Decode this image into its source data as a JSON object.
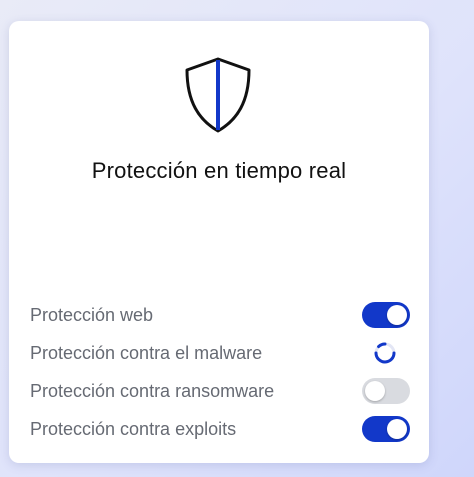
{
  "panel": {
    "title": "Protección en tiempo real",
    "icon": "shield-icon",
    "accent_color": "#1238c9"
  },
  "protections": [
    {
      "label": "Protección web",
      "state": "on"
    },
    {
      "label": "Protección contra el malware",
      "state": "loading"
    },
    {
      "label": "Protección contra ransomware",
      "state": "off"
    },
    {
      "label": "Protección contra exploits",
      "state": "on"
    }
  ]
}
